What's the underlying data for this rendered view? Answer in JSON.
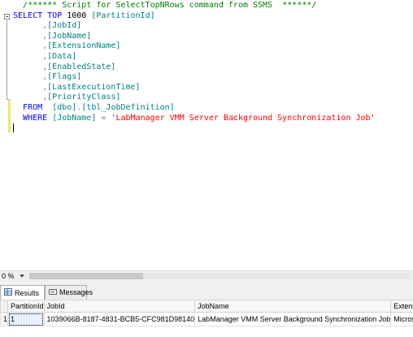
{
  "editor": {
    "lines": [
      {
        "segments": [
          {
            "t": "  ",
            "c": "blk"
          },
          {
            "t": "/****** Script for SelectTopNRows command from SSMS  ******/",
            "c": "cmt"
          }
        ]
      },
      {
        "segments": [
          {
            "t": "SELECT",
            "c": "kw"
          },
          {
            "t": " ",
            "c": "blk"
          },
          {
            "t": "TOP",
            "c": "kw"
          },
          {
            "t": " 1000 ",
            "c": "blk"
          },
          {
            "t": "[PartitionId]",
            "c": "ident"
          }
        ]
      },
      {
        "segments": [
          {
            "t": "      ",
            "c": "blk"
          },
          {
            "t": ",",
            "c": "gray"
          },
          {
            "t": "[JobId]",
            "c": "ident"
          }
        ]
      },
      {
        "segments": [
          {
            "t": "      ",
            "c": "blk"
          },
          {
            "t": ",",
            "c": "gray"
          },
          {
            "t": "[JobName]",
            "c": "ident"
          }
        ]
      },
      {
        "segments": [
          {
            "t": "      ",
            "c": "blk"
          },
          {
            "t": ",",
            "c": "gray"
          },
          {
            "t": "[ExtensionName]",
            "c": "ident"
          }
        ]
      },
      {
        "segments": [
          {
            "t": "      ",
            "c": "blk"
          },
          {
            "t": ",",
            "c": "gray"
          },
          {
            "t": "[Data]",
            "c": "ident"
          }
        ]
      },
      {
        "segments": [
          {
            "t": "      ",
            "c": "blk"
          },
          {
            "t": ",",
            "c": "gray"
          },
          {
            "t": "[EnabledState]",
            "c": "ident"
          }
        ]
      },
      {
        "segments": [
          {
            "t": "      ",
            "c": "blk"
          },
          {
            "t": ",",
            "c": "gray"
          },
          {
            "t": "[Flags]",
            "c": "ident"
          }
        ]
      },
      {
        "segments": [
          {
            "t": "      ",
            "c": "blk"
          },
          {
            "t": ",",
            "c": "gray"
          },
          {
            "t": "[LastExecutionTime]",
            "c": "ident"
          }
        ]
      },
      {
        "segments": [
          {
            "t": "      ",
            "c": "blk"
          },
          {
            "t": ",",
            "c": "gray"
          },
          {
            "t": "[PriorityClass]",
            "c": "ident"
          }
        ]
      },
      {
        "segments": [
          {
            "t": "  ",
            "c": "blk"
          },
          {
            "t": "FROM",
            "c": "kw"
          },
          {
            "t": "  ",
            "c": "blk"
          },
          {
            "t": "[dbo]",
            "c": "ident"
          },
          {
            "t": ".",
            "c": "gray"
          },
          {
            "t": "[tbl_JobDefinition]",
            "c": "ident"
          }
        ]
      },
      {
        "segments": [
          {
            "t": "  ",
            "c": "blk"
          },
          {
            "t": "WHERE",
            "c": "kw"
          },
          {
            "t": " ",
            "c": "blk"
          },
          {
            "t": "[JobName]",
            "c": "ident"
          },
          {
            "t": " ",
            "c": "blk"
          },
          {
            "t": "=",
            "c": "gray"
          },
          {
            "t": " ",
            "c": "blk"
          },
          {
            "t": "'LabManager VMM Server Background Synchronization Job'",
            "c": "str"
          }
        ]
      },
      {
        "segments": [],
        "caret": true
      }
    ]
  },
  "zoom": {
    "value": "0 %"
  },
  "tabs": [
    {
      "label": "Results",
      "active": true
    },
    {
      "label": "Messages",
      "active": false
    }
  ],
  "grid": {
    "columns": [
      "PartitionId",
      "JobId",
      "JobName",
      "Extension"
    ],
    "rows": [
      {
        "num": "1",
        "cells": [
          "1",
          "1039066B-8187-4831-BCB5-CFC981D98140",
          "LabManager VMM Server Background Synchronization Job",
          "Microsoft"
        ]
      }
    ]
  }
}
